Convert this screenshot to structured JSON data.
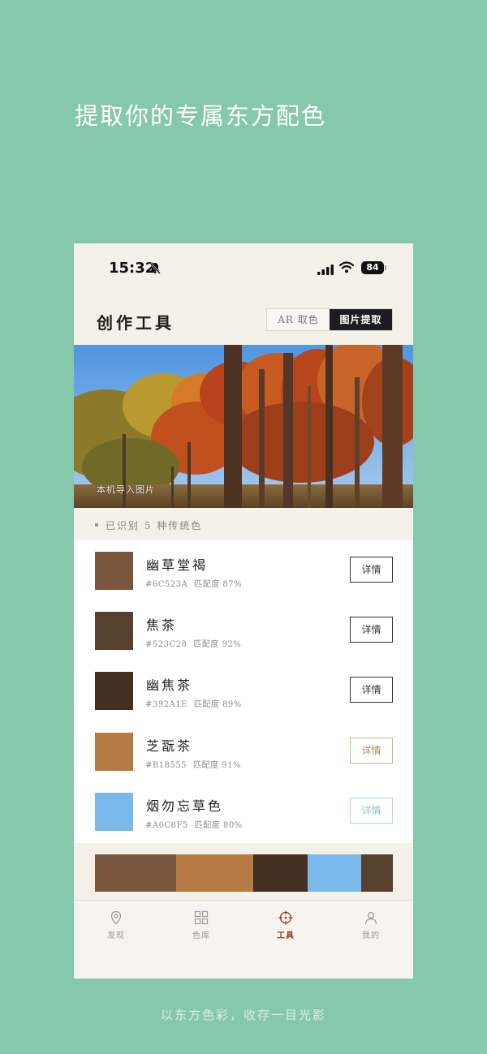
{
  "headline": "提取你的专属东方配色",
  "footline": "以东方色彩，收存一目光影",
  "status_bar": {
    "time": "15:32",
    "battery": "84"
  },
  "header": {
    "title": "创作工具",
    "segments": [
      {
        "label": "AR 取色",
        "active": false
      },
      {
        "label": "图片提取",
        "active": true
      }
    ]
  },
  "photo": {
    "caption": "本机导入图片"
  },
  "recognized_text": "已识别 5 种传统色",
  "colors": [
    {
      "name": "幽草堂褐",
      "hex": "#6C523A",
      "match": "匹配度 87%",
      "swatch": "#7a563c",
      "detail_label": "详情",
      "detail_color": "#333333"
    },
    {
      "name": "焦茶",
      "hex": "#523C28",
      "match": "匹配度 92%",
      "swatch": "#56402e",
      "detail_label": "详情",
      "detail_color": "#333333"
    },
    {
      "name": "幽焦茶",
      "hex": "#392A1E",
      "match": "匹配度 89%",
      "swatch": "#432e22",
      "detail_label": "详情",
      "detail_color": "#333333"
    },
    {
      "name": "芝翫茶",
      "hex": "#B18555",
      "match": "匹配度 91%",
      "swatch": "#b67b43",
      "detail_label": "详情",
      "detail_color": "#b08a5e"
    },
    {
      "name": "烟勿忘草色",
      "hex": "#A0C8F5",
      "match": "匹配度 80%",
      "swatch": "#7ab9ea",
      "detail_label": "详情",
      "detail_color": "#93bfe0"
    }
  ],
  "palette": [
    {
      "color": "#7a563c",
      "weight": 100
    },
    {
      "color": "#b67b43",
      "weight": 95
    },
    {
      "color": "#432e22",
      "weight": 67
    },
    {
      "color": "#7ab9ea",
      "weight": 66
    },
    {
      "color": "#56402e",
      "weight": 39
    }
  ],
  "tabs": [
    {
      "label": "发现",
      "icon": "location-pin-icon",
      "active": false
    },
    {
      "label": "色库",
      "icon": "grid-icon",
      "active": false
    },
    {
      "label": "工具",
      "icon": "crosshair-icon",
      "active": true
    },
    {
      "label": "我的",
      "icon": "user-icon",
      "active": false
    }
  ],
  "accent_color": "#a3322b"
}
